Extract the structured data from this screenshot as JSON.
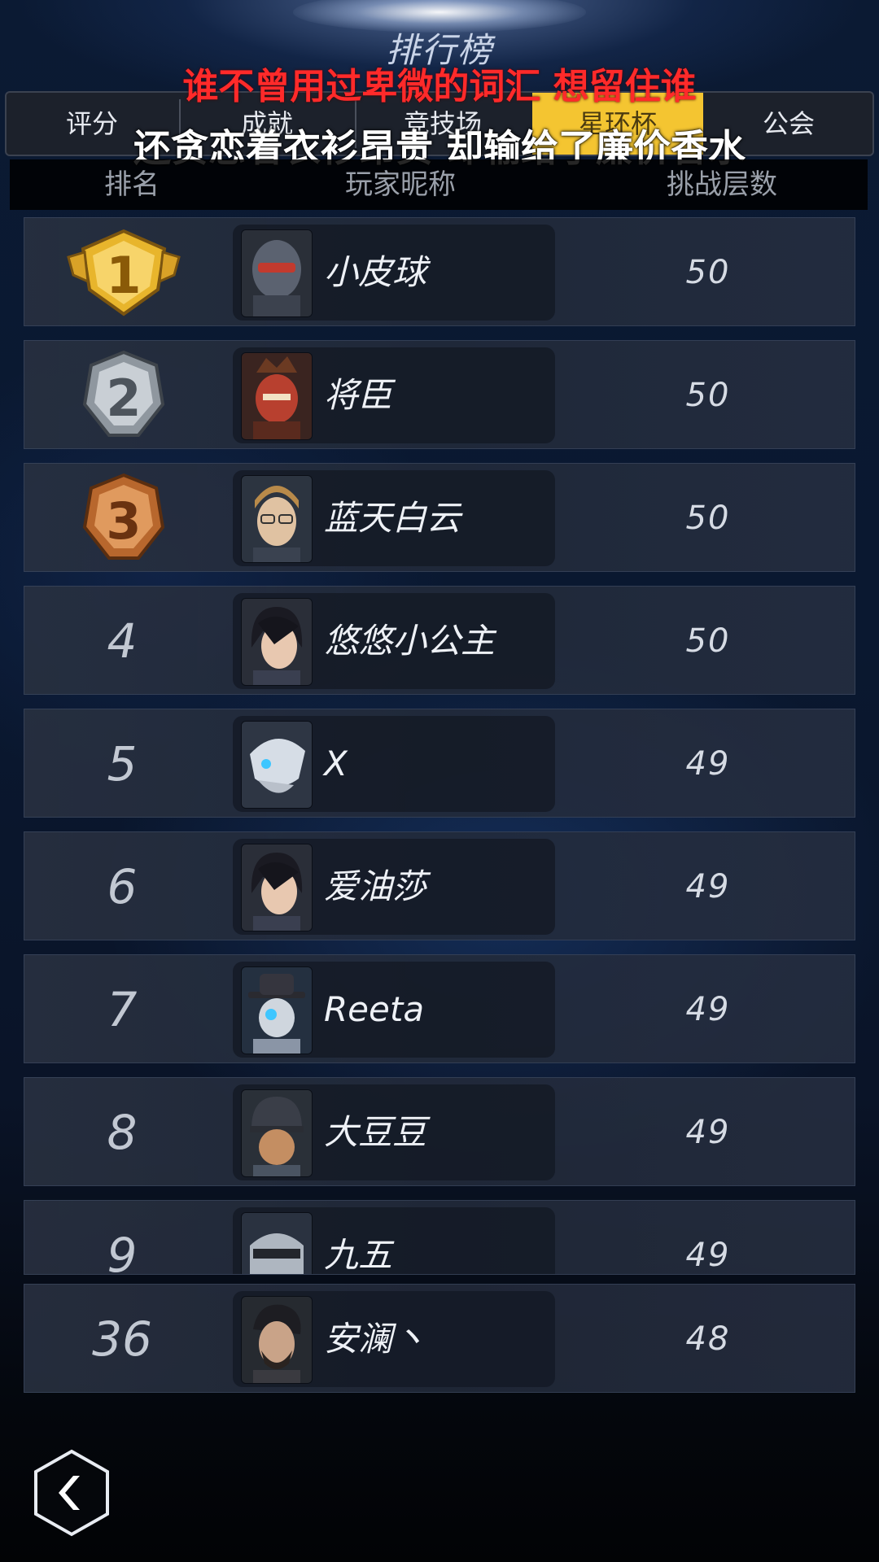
{
  "title": "排行榜",
  "tabs": [
    {
      "label": "评分"
    },
    {
      "label": "成就"
    },
    {
      "label": "竞技场"
    },
    {
      "label": "星环杯"
    },
    {
      "label": "公会"
    }
  ],
  "active_tab": "星环杯",
  "lyrics": {
    "line1": "谁不曾用过卑微的词汇 想留住谁",
    "line2": "还贪恋着衣衫昂贵 却输给了廉价香水"
  },
  "columns": {
    "rank": "排名",
    "nickname": "玩家昵称",
    "floors": "挑战层数"
  },
  "rows": [
    {
      "rank": "1",
      "name": "小皮球",
      "score": "50",
      "medal": "gold",
      "avatar": "robot-helmet-avatar"
    },
    {
      "rank": "2",
      "name": "将臣",
      "score": "50",
      "medal": "silver",
      "avatar": "red-warrior-avatar"
    },
    {
      "rank": "3",
      "name": "蓝天白云",
      "score": "50",
      "medal": "bronze",
      "avatar": "glasses-man-avatar"
    },
    {
      "rank": "4",
      "name": "悠悠小公主",
      "score": "50",
      "medal": "",
      "avatar": "dark-hair-woman-avatar"
    },
    {
      "rank": "5",
      "name": "X",
      "score": "49",
      "medal": "",
      "avatar": "white-helmet-avatar"
    },
    {
      "rank": "6",
      "name": "爱油莎",
      "score": "49",
      "medal": "",
      "avatar": "dark-hair-woman-avatar"
    },
    {
      "rank": "7",
      "name": "Reeta",
      "score": "49",
      "medal": "",
      "avatar": "fedora-robot-avatar"
    },
    {
      "rank": "8",
      "name": "大豆豆",
      "score": "49",
      "medal": "",
      "avatar": "helmet-man-avatar"
    },
    {
      "rank": "9",
      "name": "九五",
      "score": "49",
      "medal": "",
      "avatar": "visor-robot-avatar"
    }
  ],
  "self_row": {
    "rank": "36",
    "name": "安澜丶",
    "score": "48",
    "avatar": "bearded-man-avatar"
  },
  "colors": {
    "active_tab": "#f4c531",
    "lyric_red": "#ff2a2a",
    "gold": "#e8b52c",
    "silver": "#a9b0b8",
    "bronze": "#c9793c"
  }
}
